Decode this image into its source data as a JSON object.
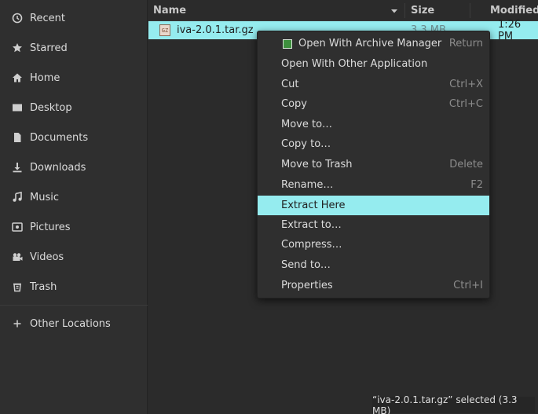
{
  "sidebar": {
    "items": [
      {
        "label": "Recent"
      },
      {
        "label": "Starred"
      },
      {
        "label": "Home"
      },
      {
        "label": "Desktop"
      },
      {
        "label": "Documents"
      },
      {
        "label": "Downloads"
      },
      {
        "label": "Music"
      },
      {
        "label": "Pictures"
      },
      {
        "label": "Videos"
      },
      {
        "label": "Trash"
      }
    ],
    "other_locations": "Other Locations"
  },
  "header": {
    "name": "Name",
    "size": "Size",
    "modified": "Modified"
  },
  "file": {
    "icon_text": "GZ",
    "name": "iva-2.0.1.tar.gz",
    "size": "3.3 MB",
    "modified": "1:26 PM"
  },
  "context_menu": {
    "items": [
      {
        "label": "Open With Archive Manager",
        "accel": "Return"
      },
      {
        "label": "Open With Other Application",
        "accel": ""
      },
      {
        "label": "Cut",
        "accel": "Ctrl+X"
      },
      {
        "label": "Copy",
        "accel": "Ctrl+C"
      },
      {
        "label": "Move to…",
        "accel": ""
      },
      {
        "label": "Copy to…",
        "accel": ""
      },
      {
        "label": "Move to Trash",
        "accel": "Delete"
      },
      {
        "label": "Rename…",
        "accel": "F2"
      },
      {
        "label": "Extract Here",
        "accel": ""
      },
      {
        "label": "Extract to…",
        "accel": ""
      },
      {
        "label": "Compress…",
        "accel": ""
      },
      {
        "label": "Send to…",
        "accel": ""
      },
      {
        "label": "Properties",
        "accel": "Ctrl+I"
      }
    ]
  },
  "status_bar": "“iva-2.0.1.tar.gz” selected  (3.3 MB)",
  "colors": {
    "selection": "#95ecef",
    "background": "#2b2b2b",
    "sidebar": "#2f2f2f"
  }
}
